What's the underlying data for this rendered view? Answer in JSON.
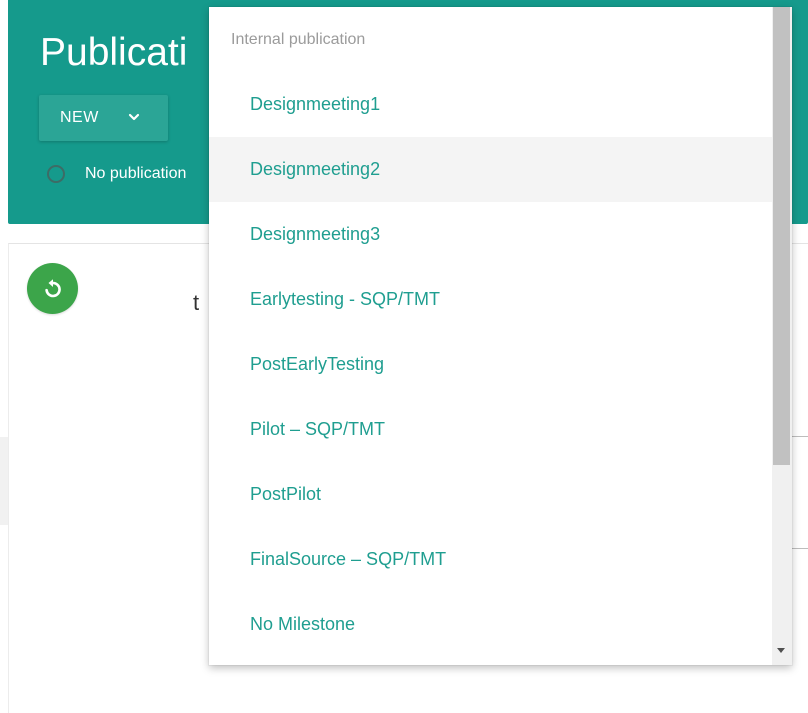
{
  "header": {
    "title": "Publicati",
    "new_label": "NEW",
    "status_text": "No publication"
  },
  "content": {
    "partial_text": "t"
  },
  "dropdown": {
    "header": "Internal publication",
    "items": [
      "Designmeeting1",
      "Designmeeting2",
      "Designmeeting3",
      "Earlytesting - SQP/TMT",
      "PostEarlyTesting",
      "Pilot – SQP/TMT",
      "PostPilot",
      "FinalSource – SQP/TMT",
      "No Milestone"
    ],
    "highlighted_item": "Designmeeting2"
  },
  "colors": {
    "header_bg": "#159a8c",
    "menu_text": "#1f9e90",
    "refresh_bg": "#3ca54a"
  },
  "icons": [
    "chevron-down-icon",
    "radio-icon",
    "refresh-icon",
    "scroll-down-arrow-icon"
  ]
}
